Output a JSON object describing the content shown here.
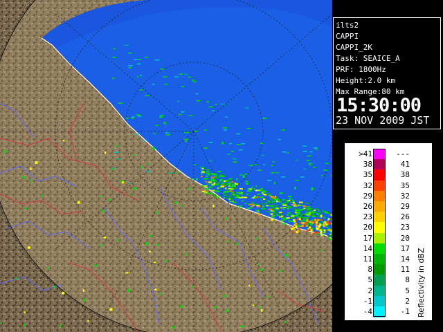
{
  "radar": {
    "site": "ilts2",
    "product": "CAPPI",
    "product_id": "CAPPI_2K",
    "task": "Task: SEAICE_A",
    "prf": "PRF: 1800Hz",
    "height": "Height:2.0 km",
    "max_range": "Max Range:80 km",
    "time": "15:30:00",
    "date": "23 NOV 2009 JST"
  },
  "legend": {
    "unit": "Reflectivity in dBZ",
    "rows": [
      {
        "lo": ">41",
        "hi": "---",
        "color": "#ff00ff"
      },
      {
        "lo": "38",
        "hi": "41",
        "color": "#b0005a"
      },
      {
        "lo": "35",
        "hi": "38",
        "color": "#ff0000"
      },
      {
        "lo": "32",
        "hi": "35",
        "color": "#ff4000"
      },
      {
        "lo": "29",
        "hi": "32",
        "color": "#ff8000"
      },
      {
        "lo": "26",
        "hi": "29",
        "color": "#ffaa00"
      },
      {
        "lo": "23",
        "hi": "26",
        "color": "#ffd000"
      },
      {
        "lo": "20",
        "hi": "23",
        "color": "#ffff00"
      },
      {
        "lo": "17",
        "hi": "20",
        "color": "#a8f000"
      },
      {
        "lo": "14",
        "hi": "17",
        "color": "#00dc00"
      },
      {
        "lo": "11",
        "hi": "14",
        "color": "#00b400"
      },
      {
        "lo": "8",
        "hi": "11",
        "color": "#009a00"
      },
      {
        "lo": "5",
        "hi": "8",
        "color": "#00a050"
      },
      {
        "lo": "2",
        "hi": "5",
        "color": "#00b48c"
      },
      {
        "lo": "-1",
        "hi": "2",
        "color": "#00c8c8"
      },
      {
        "lo": "-4",
        "hi": "-1",
        "color": "#00f0ff"
      }
    ]
  }
}
